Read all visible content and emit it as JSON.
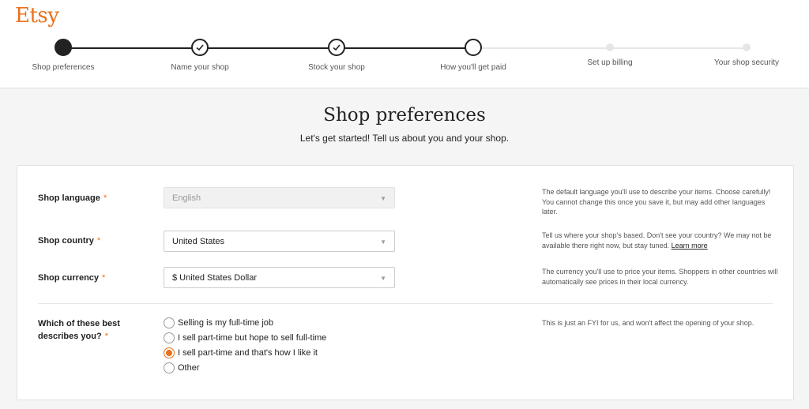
{
  "brand": {
    "logo": "Etsy",
    "accent": "#e9711c"
  },
  "steps": [
    {
      "label": "Shop preferences",
      "state": "current"
    },
    {
      "label": "Name your shop",
      "state": "done"
    },
    {
      "label": "Stock your shop",
      "state": "done"
    },
    {
      "label": "How you'll get paid",
      "state": "next"
    },
    {
      "label": "Set up billing",
      "state": "upcoming"
    },
    {
      "label": "Your shop security",
      "state": "upcoming"
    }
  ],
  "page": {
    "title": "Shop preferences",
    "subtitle": "Let's get started! Tell us about you and your shop."
  },
  "form": {
    "required_marker": "*",
    "language": {
      "label": "Shop language",
      "value": "English",
      "disabled": true,
      "help": "The default language you'll use to describe your items. Choose carefully! You cannot change this once you save it, but may add other languages later."
    },
    "country": {
      "label": "Shop country",
      "value": "United States",
      "help": "Tell us where your shop's based. Don't see your country? We may not be available there right now, but stay tuned.",
      "help_link": "Learn more"
    },
    "currency": {
      "label": "Shop currency",
      "value": "$ United States Dollar",
      "help": "The currency you'll use to price your items. Shoppers in other countries will automatically see prices in their local currency."
    },
    "describes": {
      "label_line1": "Which of these best",
      "label_line2": "describes you?",
      "help": "This is just an FYI for us, and won't affect the opening of your shop.",
      "options": [
        {
          "label": "Selling is my full-time job",
          "checked": false
        },
        {
          "label": "I sell part-time but hope to sell full-time",
          "checked": false
        },
        {
          "label": "I sell part-time and that's how I like it",
          "checked": true
        },
        {
          "label": "Other",
          "checked": false
        }
      ]
    }
  }
}
